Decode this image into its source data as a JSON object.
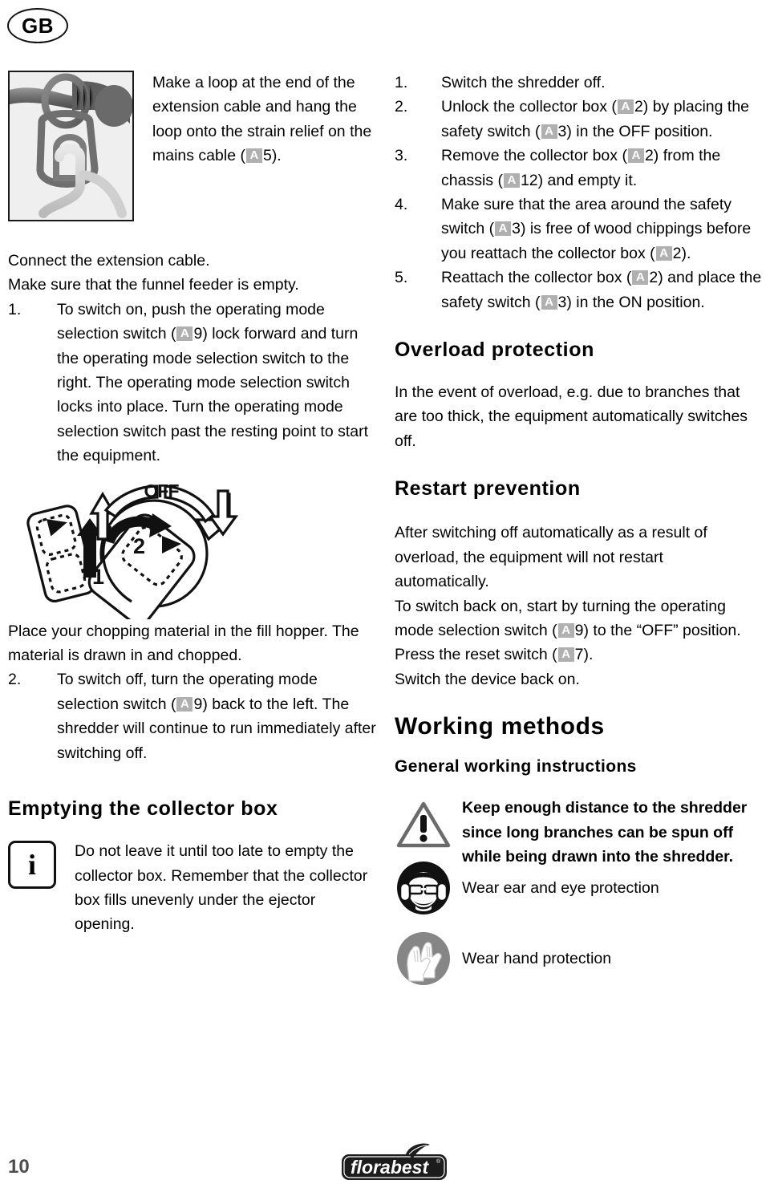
{
  "page": {
    "language_badge": "GB",
    "page_number": "10",
    "brand": "florabest",
    "ref_chip_label": "A",
    "ref_chip_color": "#b0b0b0"
  },
  "left_column": {
    "figure": {
      "photo_alt": "cable-loop-on-strain-relief-photo",
      "caption": {
        "before_ref": "Make a loop at the end of the extension cable and hang the loop onto the strain relief on the mains cable (",
        "ref": "A",
        "after_ref": "5)."
      }
    },
    "intro_lines": [
      "Connect the extension cable.",
      "Make sure that the funnel feeder is empty."
    ],
    "step_1": {
      "number": "1.",
      "part_a": "To switch on, push the operating mode selection switch (",
      "ref": "A",
      "part_b": "9) lock forward and turn the operating mode selection switch to the right.",
      "part_c": "The operating mode selection switch locks into place.",
      "part_d": "Turn the operating mode selection switch past the resting point to start the equipment."
    },
    "switch_diagram": {
      "label_off": "OFF",
      "label_arrow_1": "1",
      "label_arrow_2": "2"
    },
    "after_diagram": "Place your chopping material in the fill hopper. The material is drawn in and chopped.",
    "step_2": {
      "number": "2.",
      "part_a": "To switch off, turn the operating mode selection switch (",
      "ref": "A",
      "part_b": "9) back to the left.",
      "part_c": "The shredder will continue to run immediately after switching off."
    },
    "emptying_heading": "Emptying the collector box",
    "emptying_note": {
      "icon": "info-icon",
      "text": "Do not leave it until too late to empty the collector box. Remember that the collector box fills unevenly under the ejector opening."
    }
  },
  "right_column": {
    "steps": [
      {
        "number": "1.",
        "part_a": "Switch the shredder off.",
        "refs": []
      },
      {
        "number": "2.",
        "part_a": "Unlock the collector box (",
        "ref1": "A",
        "part_b": "2) by placing the safety switch (",
        "ref2": "A",
        "part_c": "3) in the OFF position."
      },
      {
        "number": "3.",
        "part_a": "Remove the collector box (",
        "ref1": "A",
        "part_b": "2) from the chassis (",
        "ref2": "A",
        "part_c": "12) and empty it."
      },
      {
        "number": "4.",
        "part_a": "Make sure that the area around the safety switch (",
        "ref1": "A",
        "part_b": "3) is free of wood chippings before you reattach the collector box (",
        "ref2": "A",
        "part_c": "2)."
      },
      {
        "number": "5.",
        "part_a": "Reattach the collector box (",
        "ref1": "A",
        "part_b": "2) and place the safety switch (",
        "ref2": "A",
        "part_c": "3) in the ON position."
      }
    ],
    "overload_heading": "Overload protection",
    "overload_body": "In the event of overload, e.g. due to branches that are too thick, the equipment automatically switches off.",
    "restart_heading": "Restart prevention",
    "restart_body": {
      "part_a": "After switching off automatically as a result of overload, the equipment will not restart automatically.",
      "part_b": "To switch back on, start by turning the operating mode selection switch (",
      "ref1": "A",
      "part_c": "9) to the “OFF” position.",
      "part_d": "Press the reset switch (",
      "ref2": "A",
      "part_e": "7).",
      "part_f": "Switch the device back on."
    },
    "working_methods_heading": "Working methods",
    "general_instructions_heading": "General working instructions",
    "safety_items": [
      {
        "icon": "warning-triangle-icon",
        "bold": true,
        "text": "Keep enough distance to the shredder since long branches can be spun off while being drawn into the shredder."
      },
      {
        "icon": "ear-eye-protection-icon",
        "bold": false,
        "text": "Wear ear and eye protection"
      },
      {
        "icon": "hand-protection-icon",
        "bold": false,
        "text": "Wear hand protection"
      }
    ]
  }
}
